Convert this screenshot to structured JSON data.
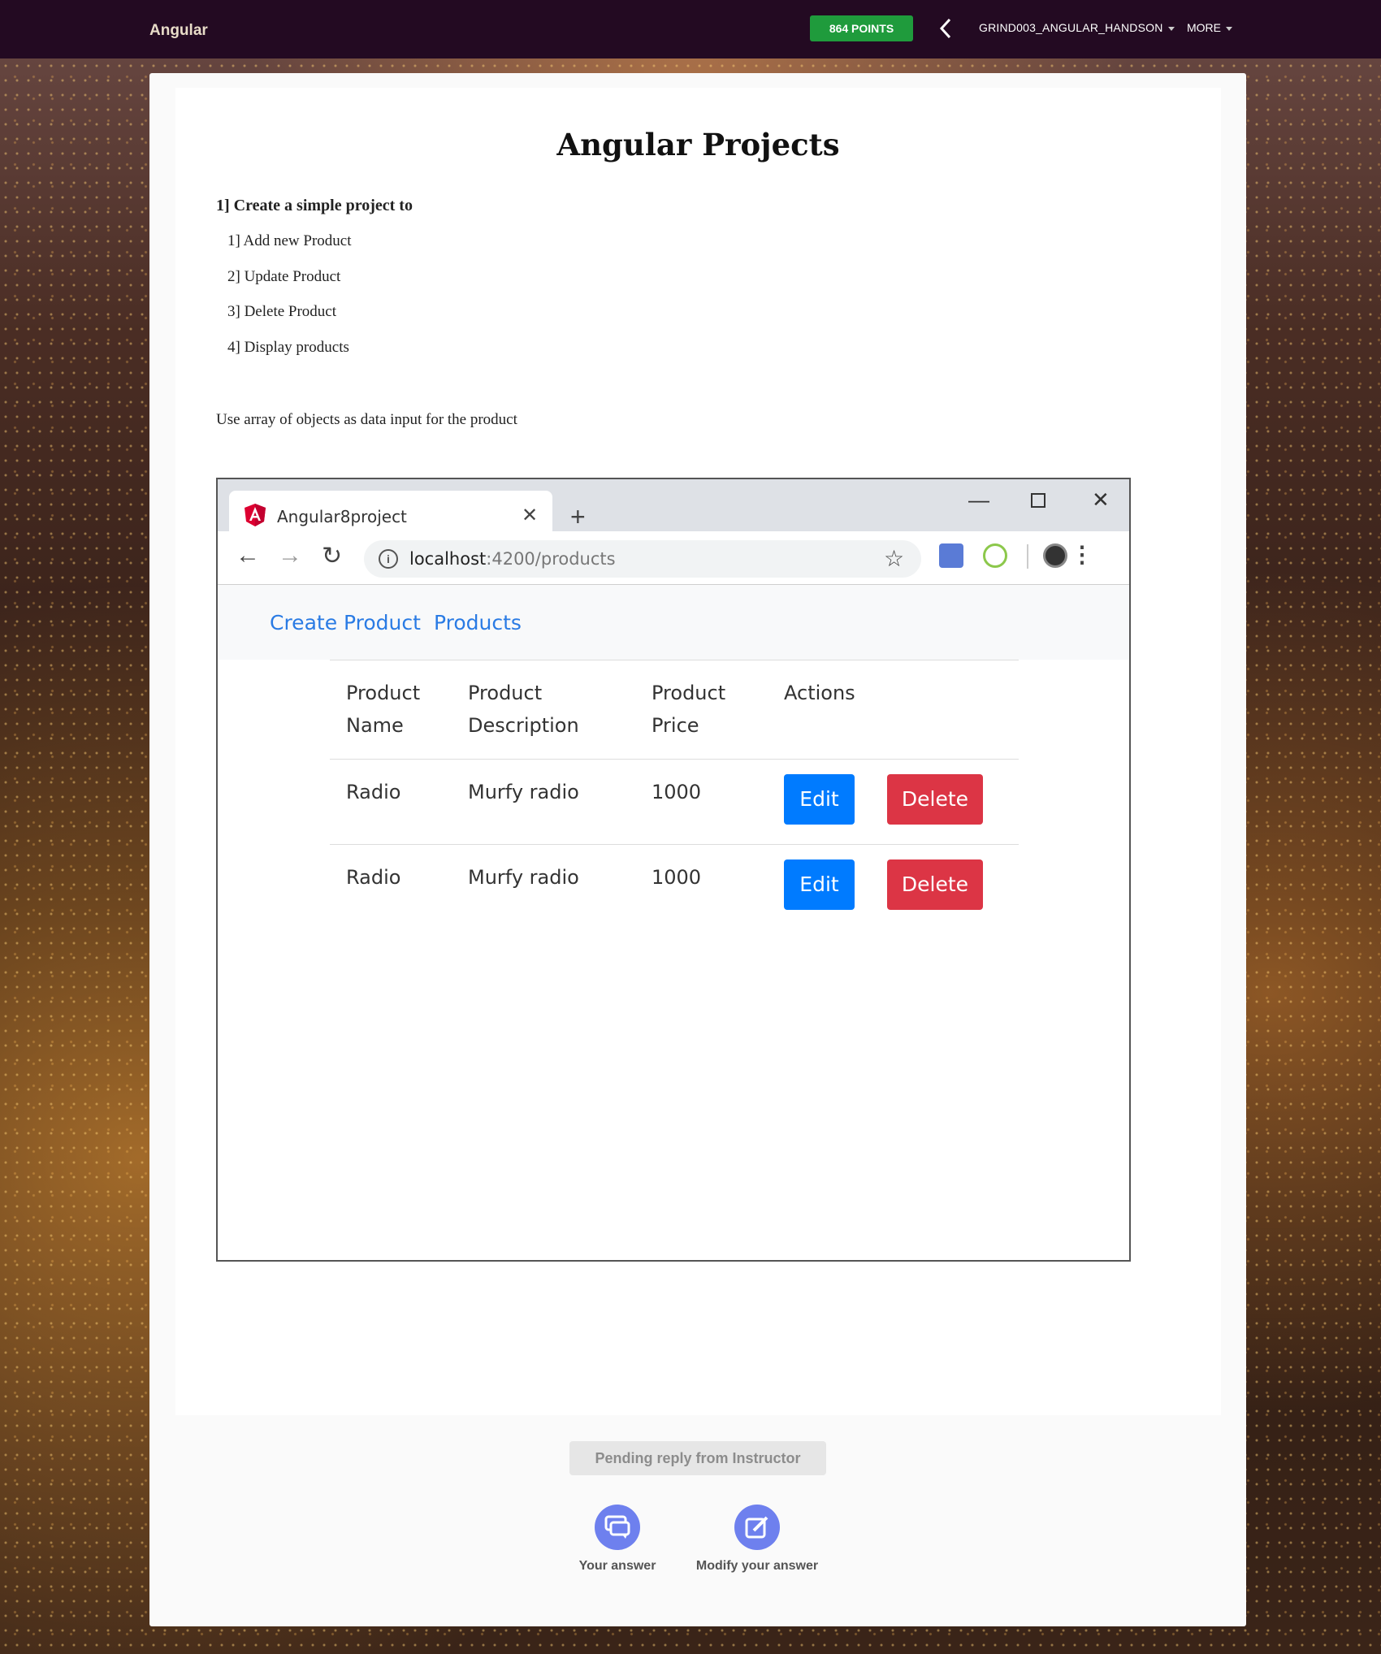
{
  "topbar": {
    "brand": "Angular",
    "points": "864 POINTS",
    "user": "GRIND003_ANGULAR_HANDSON",
    "more": "MORE"
  },
  "question": {
    "title": "Angular Projects",
    "heading": "1] Create a simple project to",
    "items": [
      "1] Add new Product",
      "2] Update Product",
      "3] Delete Product",
      "4] Display products"
    ],
    "note": "Use array of objects as data input for the product"
  },
  "browser": {
    "tab_title": "Angular8project",
    "url_host": "localhost",
    "url_path": ":4200/products",
    "nav_links": [
      "Create Product",
      "Products"
    ],
    "table": {
      "headers": [
        [
          "Product",
          "Name"
        ],
        [
          "Product",
          "Description"
        ],
        [
          "Product",
          "Price"
        ],
        [
          "Actions",
          ""
        ]
      ],
      "rows": [
        {
          "name": "Radio",
          "description": "Murfy radio",
          "price": "1000",
          "edit": "Edit",
          "delete": "Delete"
        },
        {
          "name": "Radio",
          "description": "Murfy radio",
          "price": "1000",
          "edit": "Edit",
          "delete": "Delete"
        }
      ]
    }
  },
  "footer": {
    "status": "Pending reply from Instructor",
    "your_answer": "Your answer",
    "modify_answer": "Modify your answer"
  },
  "colors": {
    "topbar": "#230a22",
    "points_badge": "#1f9b3c",
    "edit_button": "#007bff",
    "delete_button": "#dc3545",
    "link": "#2a7be4",
    "action_circle": "#6e80ee"
  },
  "icons": {
    "back": "chevron-left-icon",
    "dropdown": "caret-down-icon",
    "favicon": "angular-logo-icon",
    "info": "info-icon",
    "star": "star-icon",
    "your_answer": "chat-bubbles-icon",
    "modify_answer": "edit-pencil-icon"
  }
}
